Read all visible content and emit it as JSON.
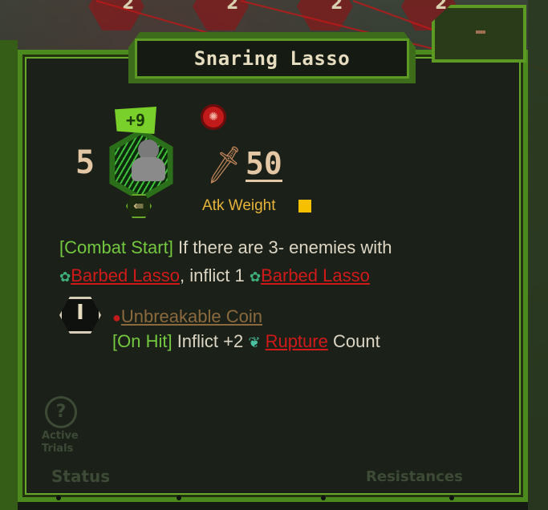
{
  "background": {
    "numbers": [
      "2",
      "2",
      "2",
      "2"
    ]
  },
  "popup": {
    "title": "Snaring Lasso",
    "skill": {
      "level_badge": "+9",
      "coin_power": "5",
      "attack_value": "50",
      "atk_weight_label": "Atk Weight",
      "icon": "lasso-skill-icon"
    },
    "description": {
      "line1_tag": "[Combat Start]",
      "line1_text": " If there are 3- enemies with",
      "line2_kw1": "Barbed Lasso",
      "line2_mid": ", inflict 1 ",
      "line2_kw2": "Barbed Lasso"
    },
    "coin": {
      "numeral": "I",
      "name": "Unbreakable Coin",
      "effect_tag": "[On Hit]",
      "effect_text": " Inflict +2 ",
      "effect_kw": "Rupture",
      "effect_tail": " Count"
    },
    "faded_labels": {
      "question": "?",
      "active_trials": "Active\nTrials",
      "status": "Status",
      "resistances": "Resistances"
    }
  },
  "colors": {
    "frame_green": "#4d8a1e",
    "keyword_red": "#d01a1a",
    "tag_green": "#74c840",
    "atk_weight_yellow": "#f5c000"
  }
}
